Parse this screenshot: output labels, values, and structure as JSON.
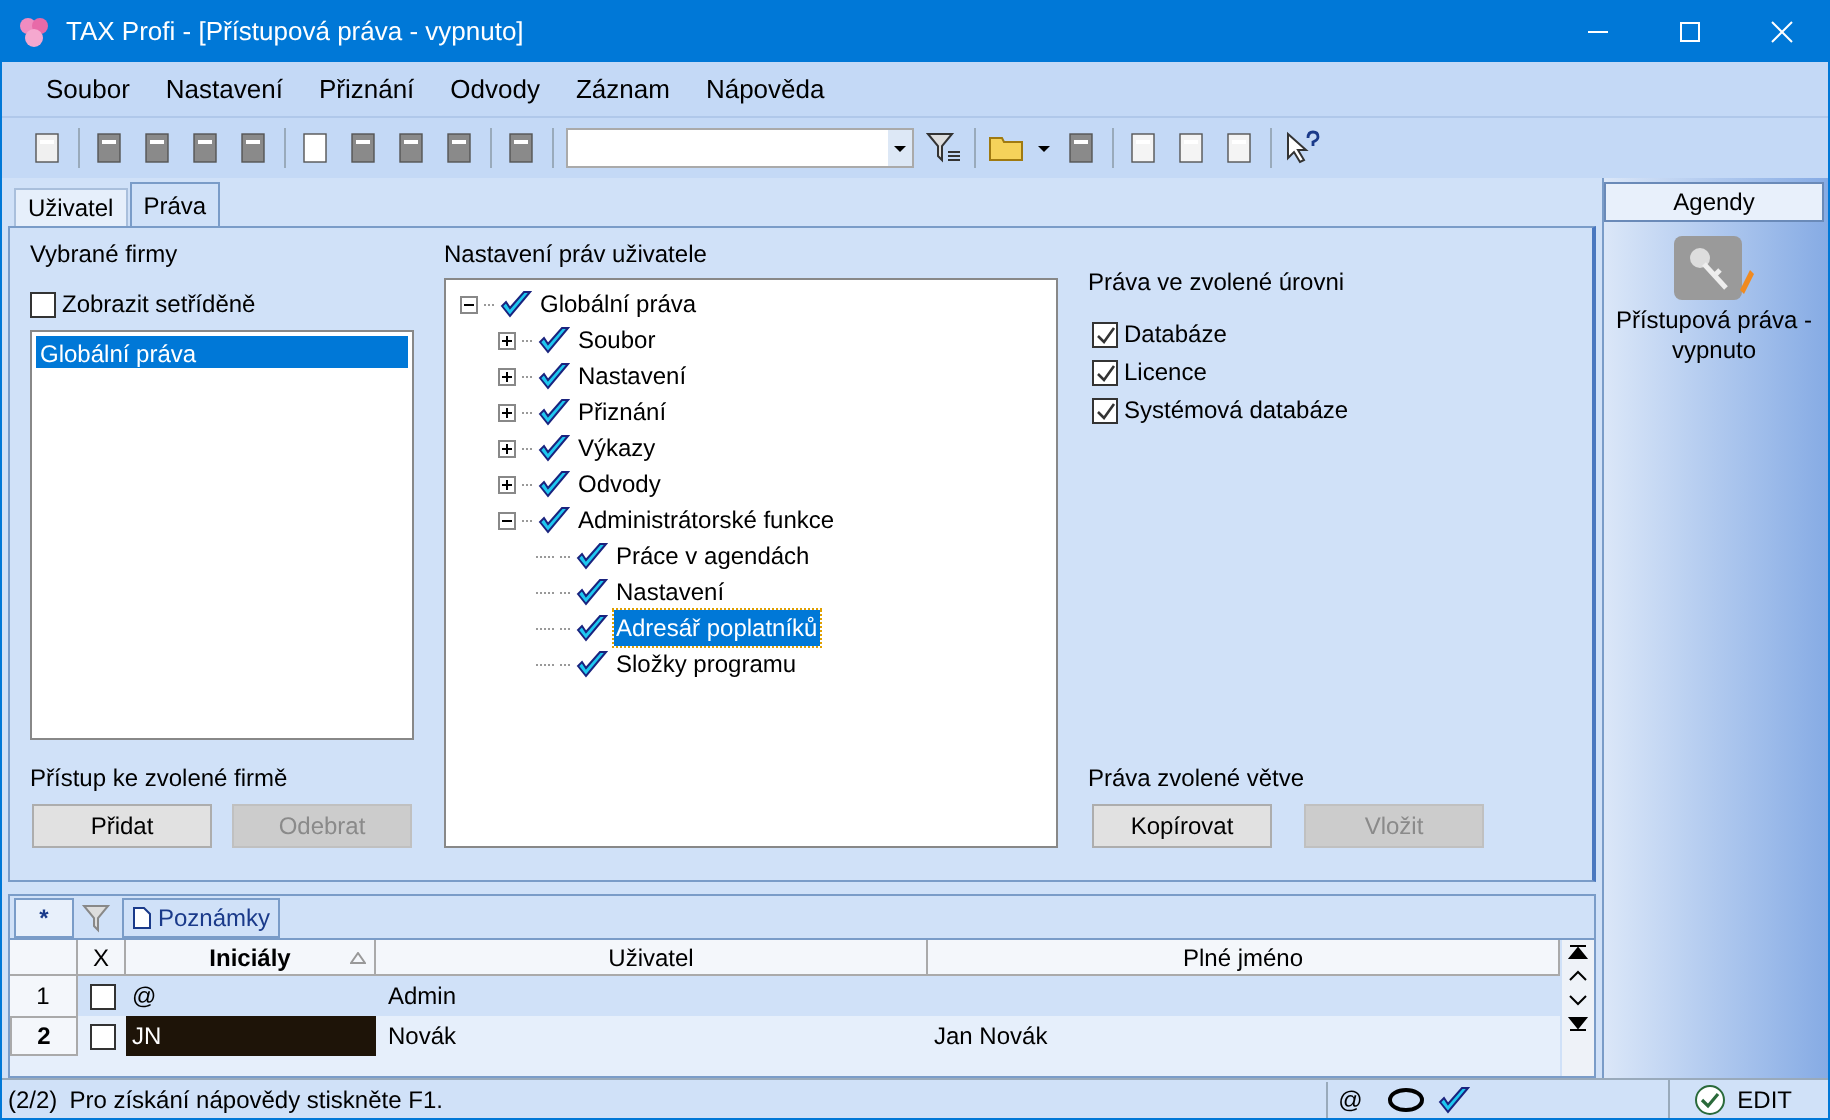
{
  "window": {
    "title": "TAX Profi - [Přístupová práva - vypnuto]"
  },
  "menu": [
    "Soubor",
    "Nastavení",
    "Přiznání",
    "Odvody",
    "Záznam",
    "Nápověda"
  ],
  "tabs": [
    {
      "label": "Uživatel",
      "selected": false
    },
    {
      "label": "Práva",
      "selected": true
    }
  ],
  "firms": {
    "title": "Vybrané firmy",
    "sort_checkbox": {
      "label": "Zobrazit setříděně",
      "checked": false
    },
    "items": [
      {
        "label": "Globální práva",
        "selected": true
      }
    ],
    "access_title": "Přístup ke zvolené firmě",
    "buttons": [
      {
        "label": "Přidat",
        "disabled": false
      },
      {
        "label": "Odebrat",
        "disabled": true
      }
    ]
  },
  "rights_tree": {
    "title": "Nastavení práv uživatele",
    "nodes": [
      {
        "label": "Globální práva",
        "expanded": true,
        "selected": false,
        "children": [
          {
            "label": "Soubor",
            "expanded": false,
            "selected": false
          },
          {
            "label": "Nastavení",
            "expanded": false,
            "selected": false
          },
          {
            "label": "Přiznání",
            "expanded": false,
            "selected": false
          },
          {
            "label": "Výkazy",
            "expanded": false,
            "selected": false
          },
          {
            "label": "Odvody",
            "expanded": false,
            "selected": false
          },
          {
            "label": "Administrátorské funkce",
            "expanded": true,
            "selected": false,
            "children": [
              {
                "label": "Práce v agendách",
                "selected": false
              },
              {
                "label": "Nastavení",
                "selected": false
              },
              {
                "label": "Adresář poplatníků",
                "selected": true
              },
              {
                "label": "Složky programu",
                "selected": false
              }
            ]
          }
        ]
      }
    ]
  },
  "level_rights": {
    "title": "Práva ve zvolené úrovni",
    "items": [
      {
        "label": "Databáze",
        "checked": true
      },
      {
        "label": "Licence",
        "checked": true
      },
      {
        "label": "Systémová databáze",
        "checked": true
      }
    ]
  },
  "branch_rights": {
    "title": "Práva zvolené větve",
    "buttons": [
      {
        "label": "Kopírovat",
        "disabled": false
      },
      {
        "label": "Vložit",
        "disabled": true
      }
    ]
  },
  "agendy": {
    "title": "Agendy",
    "item": "Přístupová práva - vypnuto"
  },
  "bottom_tabs": {
    "new_tab": "*",
    "notes_tab": "Poznámky"
  },
  "grid": {
    "columns": [
      "X",
      "Iniciály",
      "Uživatel",
      "Plné jméno"
    ],
    "rows": [
      {
        "number": "1",
        "checked": false,
        "initials": "@",
        "user": "Admin",
        "full_name": "",
        "selected": false
      },
      {
        "number": "2",
        "checked": false,
        "initials": "JN",
        "user": "Novák",
        "full_name": "Jan Novák",
        "selected": true
      }
    ]
  },
  "status_bar": {
    "count": "(2/2)",
    "message": "Pro získání nápovědy stiskněte F1.",
    "at": "@",
    "mode": "EDIT"
  }
}
